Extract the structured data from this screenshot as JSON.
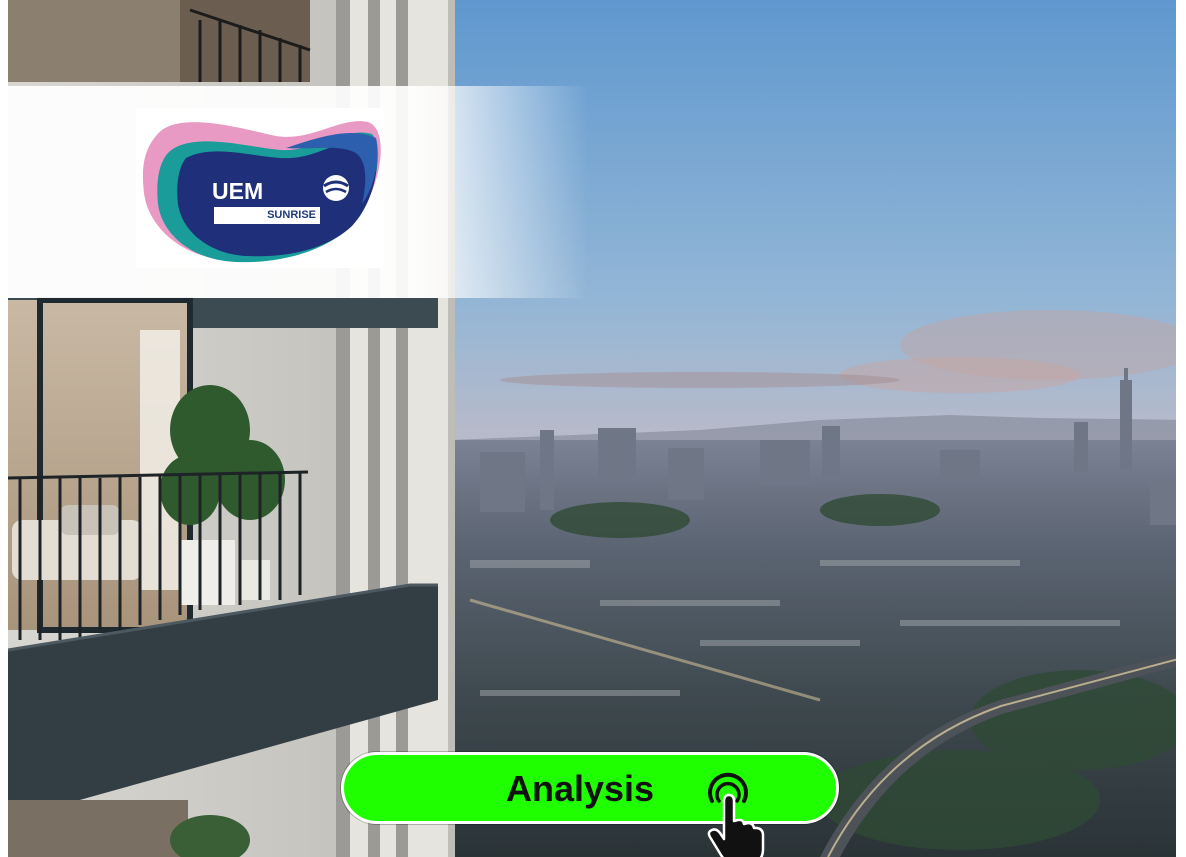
{
  "brand": {
    "main": "UEM",
    "sub": "SUNRISE",
    "colors": {
      "pink": "#e99ac4",
      "teal": "#1a9c9a",
      "navy": "#1f2f7a",
      "blue": "#2c5fae"
    }
  },
  "action_button": {
    "label": "Analysis",
    "color": "#20ff00",
    "icon": "pointing-hand-tap-icon"
  },
  "scene": {
    "icon": "city-skyline-balcony-photo"
  }
}
